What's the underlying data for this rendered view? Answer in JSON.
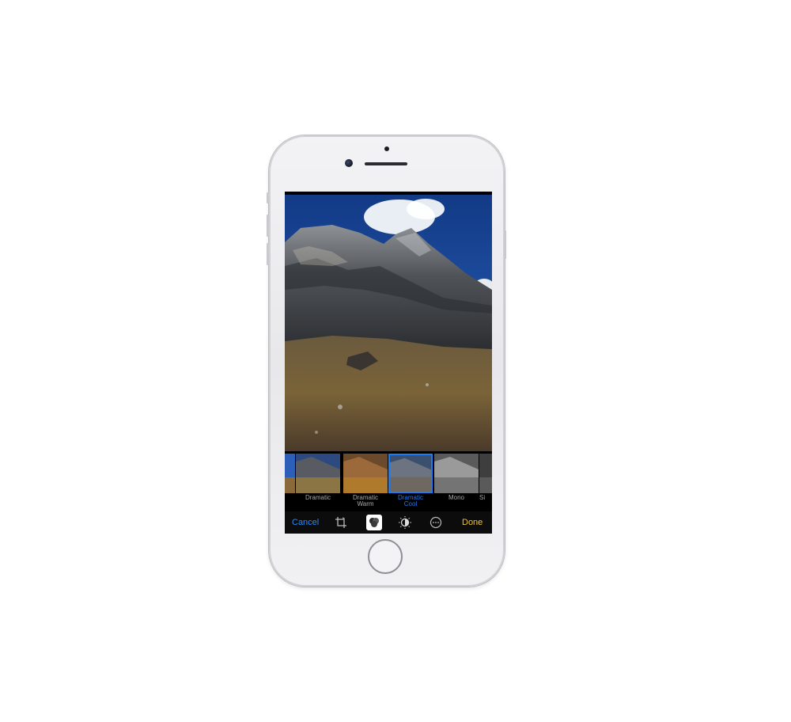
{
  "editor": {
    "cancel_label": "Cancel",
    "done_label": "Done",
    "tools": [
      {
        "name": "crop-icon"
      },
      {
        "name": "filters-icon",
        "active": true
      },
      {
        "name": "adjust-icon"
      },
      {
        "name": "more-icon"
      }
    ]
  },
  "filters": [
    {
      "label": "Dramatic",
      "label2": ""
    },
    {
      "label": "Dramatic",
      "label2": "Warm"
    },
    {
      "label": "Dramatic",
      "label2": "Cool",
      "selected": true
    },
    {
      "label": "Mono",
      "label2": ""
    },
    {
      "label": "Si",
      "label2": ""
    }
  ],
  "colors": {
    "accent_blue": "#1e7cf2",
    "done_yellow": "#f1c232",
    "phone_body": "#ececef"
  }
}
